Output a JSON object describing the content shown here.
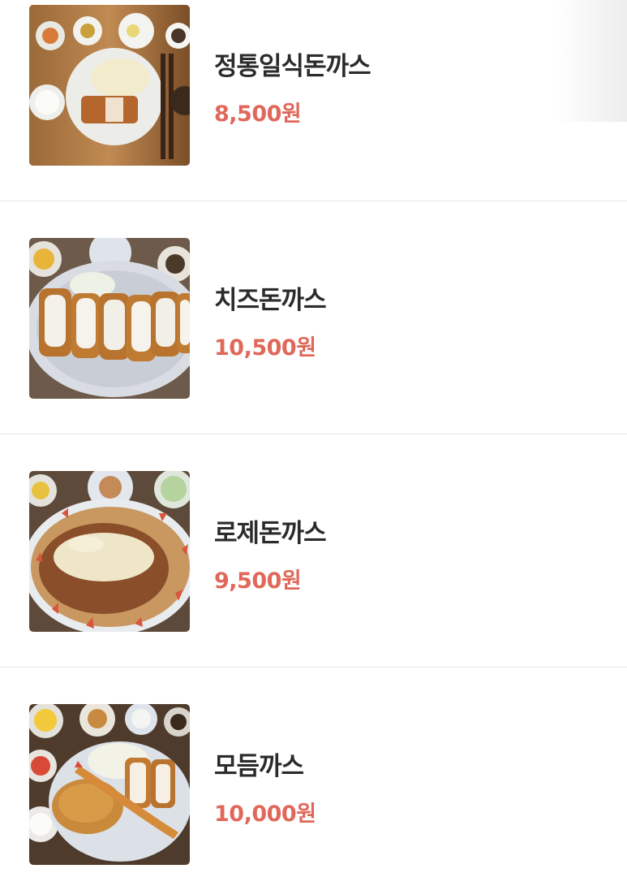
{
  "menu": {
    "items": [
      {
        "name": "정통일식돈까스",
        "price": "8,500원",
        "image_icon": "tonkatsu-set-photo"
      },
      {
        "name": "치즈돈까스",
        "price": "10,500원",
        "image_icon": "cheese-tonkatsu-photo"
      },
      {
        "name": "로제돈까스",
        "price": "9,500원",
        "image_icon": "rose-tonkatsu-photo"
      },
      {
        "name": "모듬까스",
        "price": "10,000원",
        "image_icon": "assorted-katsu-photo"
      }
    ]
  },
  "colors": {
    "price": "#e0685a",
    "name": "#2b2b2b",
    "divider": "#e6e6e6"
  }
}
